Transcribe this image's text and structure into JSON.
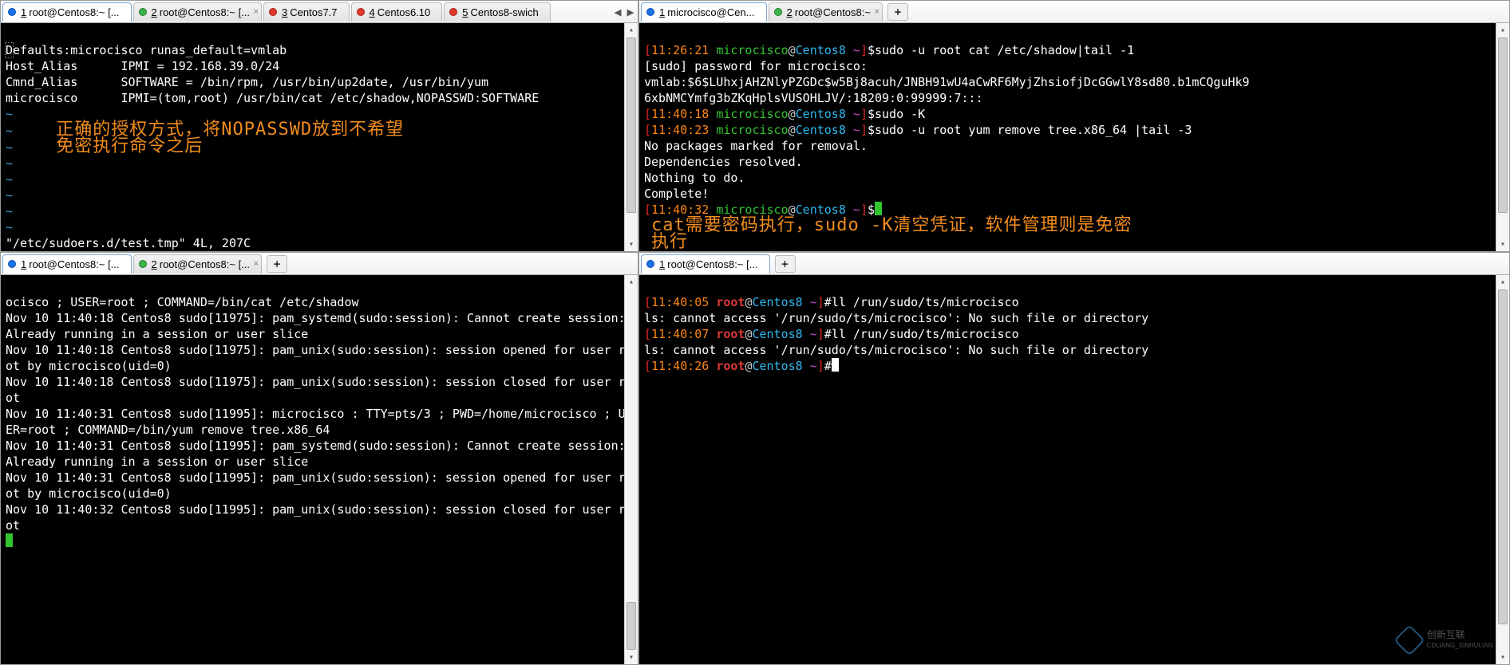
{
  "panes": {
    "tl": {
      "tabs": [
        {
          "dot": "blue",
          "num": "1",
          "label": "root@Centos8:~ [...",
          "active": true
        },
        {
          "dot": "green",
          "num": "2",
          "label": "root@Centos8:~ [...",
          "active": false
        },
        {
          "dot": "red",
          "num": "3",
          "label": "Centos7.7",
          "active": false
        },
        {
          "dot": "red",
          "num": "4",
          "label": "Centos6.10",
          "active": false
        },
        {
          "dot": "red",
          "num": "5",
          "label": "Centos8-swich",
          "active": false
        }
      ],
      "nav": {
        "left": "◀",
        "right": "▶"
      },
      "lines": {
        "l1": "Defaults:microcisco runas_default=vmlab",
        "l2": "Host_Alias      IPMI = 192.168.39.0/24",
        "l3": "Cmnd_Alias      SOFTWARE = /bin/rpm, /usr/bin/up2date, /usr/bin/yum",
        "l4": "microcisco      IPMI=(tom,root) /usr/bin/cat /etc/shadow,NOPASSWD:SOFTWARE",
        "ann1": "正确的授权方式，将NOPASSWD放到不希望",
        "ann2": "免密执行命令之后",
        "status": "\"/etc/sudoers.d/test.tmp\" 4L, 207C"
      }
    },
    "tr": {
      "tabs": [
        {
          "dot": "blue",
          "num": "1",
          "label": "microcisco@Cen...",
          "active": true
        },
        {
          "dot": "green",
          "num": "2",
          "label": "root@Centos8:~",
          "active": false
        }
      ],
      "prompt1": {
        "time": "11:26:21",
        "user": "microcisco",
        "host": "Centos8",
        "dir": "~",
        "cmd": "sudo -u root cat /etc/shadow|tail -1"
      },
      "out1": "[sudo] password for microcisco:",
      "out2": "vmlab:$6$LUhxjAHZNlyPZGDc$w5Bj8acuh/JNBH91wU4aCwRF6MyjZhsiofjDcGGwlY8sd80.b1mCQguHk96xbNMCYmfg3bZKqHplsVUSOHLJV/:18209:0:99999:7:::",
      "prompt2": {
        "time": "11:40:18",
        "user": "microcisco",
        "host": "Centos8",
        "dir": "~",
        "cmd": "sudo -K"
      },
      "prompt3": {
        "time": "11:40:23",
        "user": "microcisco",
        "host": "Centos8",
        "dir": "~",
        "cmd": "sudo -u root yum remove tree.x86_64 |tail -3"
      },
      "out3": "No packages marked for removal.",
      "out4": "Dependencies resolved.",
      "out5": "Nothing to do.",
      "out6": "Complete!",
      "prompt4": {
        "time": "11:40:32",
        "user": "microcisco",
        "host": "Centos8",
        "dir": "~",
        "cmd": ""
      },
      "ann1": "cat需要密码执行，sudo -K清空凭证，软件管理则是免密",
      "ann2": "执行"
    },
    "bl": {
      "tabs": [
        {
          "dot": "blue",
          "num": "1",
          "label": "root@Centos8:~ [...",
          "active": true
        },
        {
          "dot": "green",
          "num": "2",
          "label": "root@Centos8:~ [...",
          "active": false
        }
      ],
      "lines": {
        "l1": "ocisco ; USER=root ; COMMAND=/bin/cat /etc/shadow",
        "l2": "Nov 10 11:40:18 Centos8 sudo[11975]: pam_systemd(sudo:session): Cannot create session: Already running in a session or user slice",
        "l3": "Nov 10 11:40:18 Centos8 sudo[11975]: pam_unix(sudo:session): session opened for user root by microcisco(uid=0)",
        "l4": "Nov 10 11:40:18 Centos8 sudo[11975]: pam_unix(sudo:session): session closed for user root",
        "l5": "Nov 10 11:40:31 Centos8 sudo[11995]: microcisco : TTY=pts/3 ; PWD=/home/microcisco ; USER=root ; COMMAND=/bin/yum remove tree.x86_64",
        "l6": "Nov 10 11:40:31 Centos8 sudo[11995]: pam_systemd(sudo:session): Cannot create session: Already running in a session or user slice",
        "l7": "Nov 10 11:40:31 Centos8 sudo[11995]: pam_unix(sudo:session): session opened for user root by microcisco(uid=0)",
        "l8": "Nov 10 11:40:32 Centos8 sudo[11995]: pam_unix(sudo:session): session closed for user root"
      }
    },
    "br": {
      "tabs": [
        {
          "dot": "blue",
          "num": "1",
          "label": "root@Centos8:~ [...",
          "active": true
        }
      ],
      "prompt1": {
        "time": "11:40:05",
        "user": "root",
        "host": "Centos8",
        "dir": "~",
        "cmd": "ll /run/sudo/ts/microcisco"
      },
      "out1": "ls: cannot access '/run/sudo/ts/microcisco': No such file or directory",
      "prompt2": {
        "time": "11:40:07",
        "user": "root",
        "host": "Centos8",
        "dir": "~",
        "cmd": "ll /run/sudo/ts/microcisco"
      },
      "out2": "ls: cannot access '/run/sudo/ts/microcisco': No such file or directory",
      "prompt3": {
        "time": "11:40:26",
        "user": "root",
        "host": "Centos8",
        "dir": "~",
        "cmd": ""
      }
    }
  },
  "watermark": {
    "brand": "创新互联",
    "sub": "CDLIANG_XINHULIAN"
  }
}
